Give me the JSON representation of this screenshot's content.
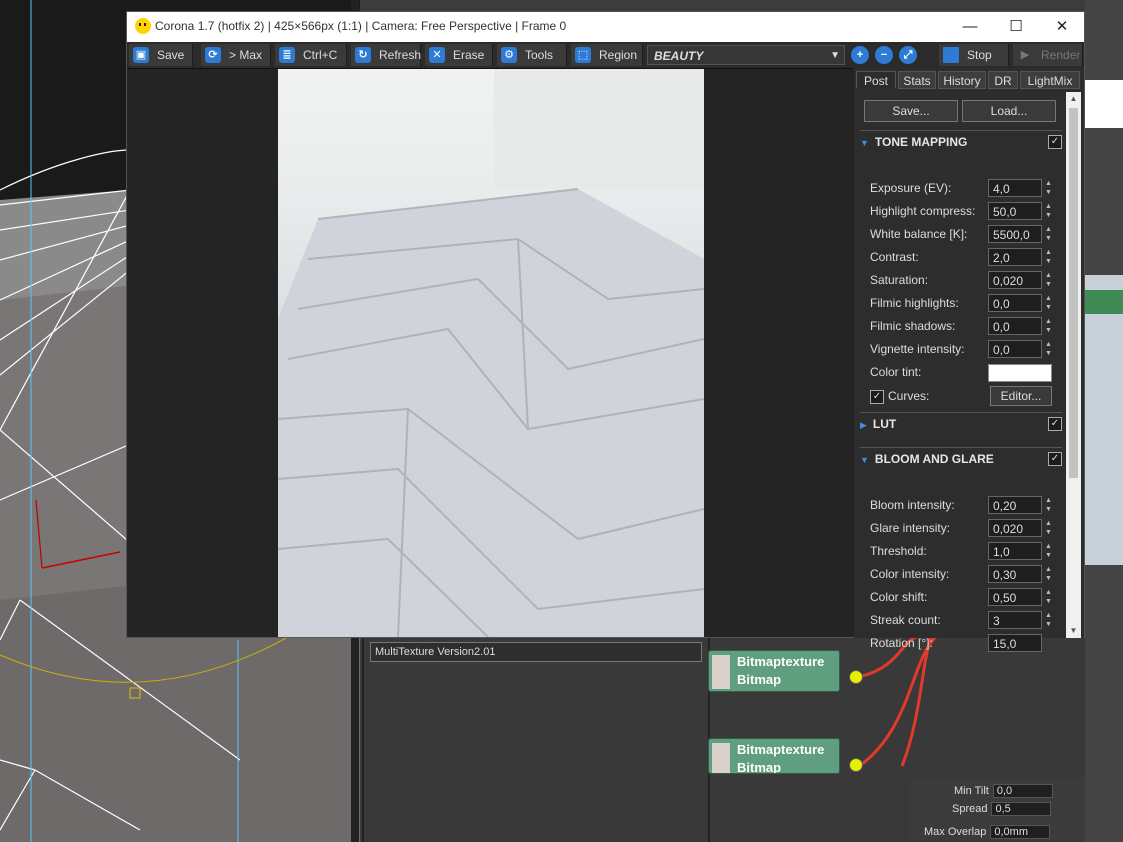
{
  "window": {
    "title": "Corona 1.7 (hotfix 2) | 425×566px (1:1) | Camera: Free Perspective | Frame 0",
    "minimize": "—",
    "maximize": "☐",
    "close": "✕"
  },
  "toolbar": {
    "save": "Save",
    "to_max": "> Max",
    "copy": "Ctrl+C",
    "refresh": "Refresh",
    "erase": "Erase",
    "tools": "Tools",
    "region": "Region",
    "render_element": "BEAUTY",
    "stop": "Stop",
    "render": "Render"
  },
  "tabs": [
    "Post",
    "Stats",
    "History",
    "DR",
    "LightMix"
  ],
  "post": {
    "save_btn": "Save...",
    "load_btn": "Load...",
    "tone_mapping": {
      "title": "TONE MAPPING",
      "enabled": true,
      "rows": [
        {
          "label": "Exposure (EV):",
          "value": "4,0"
        },
        {
          "label": "Highlight compress:",
          "value": "50,0"
        },
        {
          "label": "White balance [K]:",
          "value": "5500,0"
        },
        {
          "label": "Contrast:",
          "value": "2,0"
        },
        {
          "label": "Saturation:",
          "value": "0,020"
        },
        {
          "label": "Filmic highlights:",
          "value": "0,0"
        },
        {
          "label": "Filmic shadows:",
          "value": "0,0"
        },
        {
          "label": "Vignette intensity:",
          "value": "0,0"
        }
      ],
      "color_tint_label": "Color tint:",
      "color_tint": "#ffffff",
      "curves_label": "Curves:",
      "curves_checked": true,
      "editor_btn": "Editor..."
    },
    "lut": {
      "title": "LUT",
      "enabled": true
    },
    "bloom": {
      "title": "BLOOM AND GLARE",
      "enabled": true,
      "rows": [
        {
          "label": "Bloom intensity:",
          "value": "0,20"
        },
        {
          "label": "Glare intensity:",
          "value": "0,020"
        },
        {
          "label": "Threshold:",
          "value": "1,0"
        },
        {
          "label": "Color intensity:",
          "value": "0,30"
        },
        {
          "label": "Color shift:",
          "value": "0,50"
        },
        {
          "label": "Streak count:",
          "value": "3"
        },
        {
          "label": "Rotation [°]:",
          "value": "15,0"
        }
      ]
    }
  },
  "slate": {
    "multitexture_label": "MultiTexture Version2.01",
    "nodes": [
      {
        "line1": "Bitmaptexture",
        "line2": "Bitmap"
      },
      {
        "line1": "Bitmaptexture",
        "line2": "Bitmap"
      }
    ],
    "props": [
      {
        "label": "Min Tilt",
        "value": "0,0"
      },
      {
        "label": "Spread",
        "value": "0,5"
      },
      {
        "label": "Max Overlap",
        "value": "0,0mm"
      }
    ]
  },
  "colors": {
    "accent": "#2d7bd5",
    "node": "#5f9e7f",
    "socket": "#e7f000"
  }
}
